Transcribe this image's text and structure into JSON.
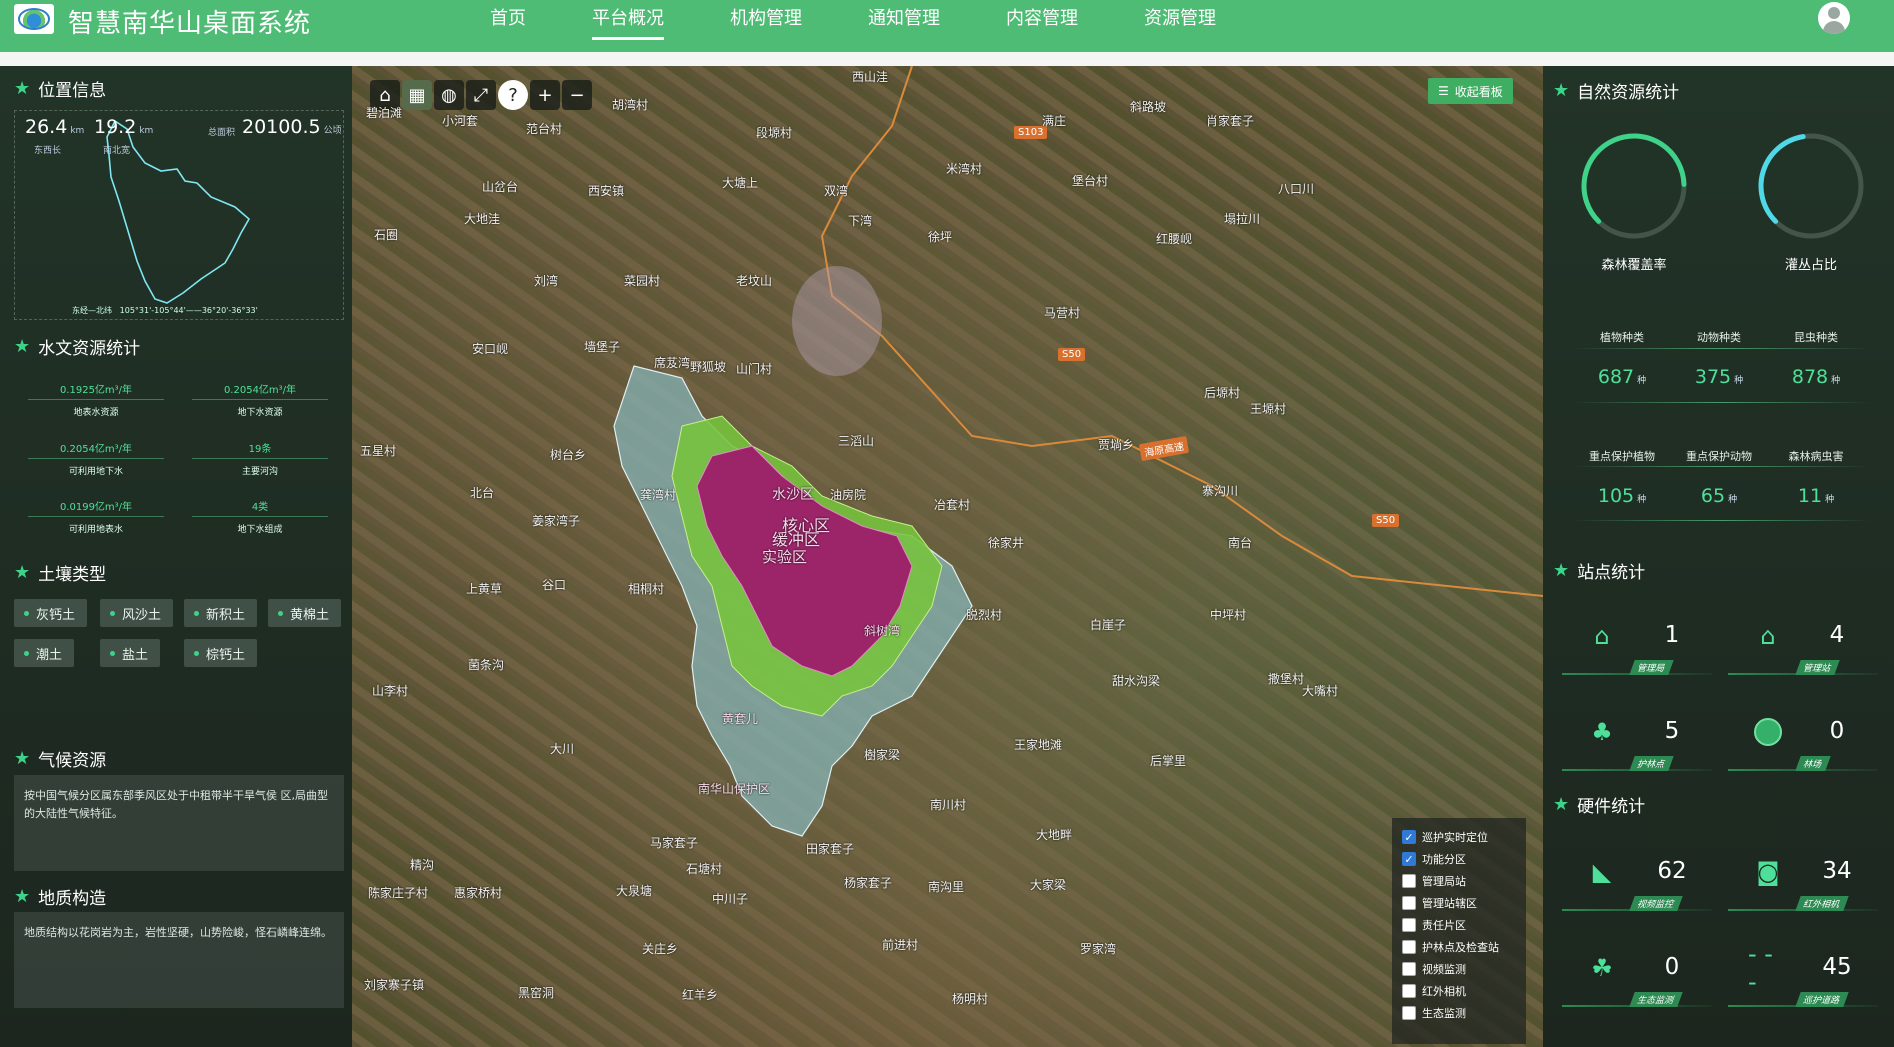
{
  "header": {
    "title": "智慧南华山桌面系统",
    "nav": [
      "首页",
      "平台概况",
      "机构管理",
      "通知管理",
      "内容管理",
      "资源管理"
    ],
    "active_nav": "平台概况"
  },
  "left": {
    "location": {
      "title": "位置信息",
      "east_west_length": "26.4",
      "north_south_length": "19.2",
      "length_unit": "km",
      "east_west_label": "东西长",
      "north_south_label": "南北宽",
      "area_label": "总面积",
      "area_value": "20100.5",
      "area_unit": "公顷",
      "coord_label": "东经—北纬",
      "coord_value": "105°31'-105°44'——36°20'-36°33'"
    },
    "hydro": {
      "title": "水文资源统计",
      "items": [
        {
          "value": "0.1925亿m³/年",
          "label": "地表水资源"
        },
        {
          "value": "0.2054亿m³/年",
          "label": "地下水资源"
        },
        {
          "value": "0.2054亿m³/年",
          "label": "可利用地下水"
        },
        {
          "value": "19条",
          "label": "主要河沟"
        },
        {
          "value": "0.0199亿m³/年",
          "label": "可利用地表水"
        },
        {
          "value": "4类",
          "label": "地下水组成"
        }
      ]
    },
    "soil": {
      "title": "土壤类型",
      "tags": [
        "灰钙土",
        "风沙土",
        "新积土",
        "黄棉土",
        "潮土",
        "盐土",
        "棕钙土"
      ]
    },
    "climate": {
      "title": "气候资源",
      "text": "按中国气候分区属东部季风区处于中租带半干旱气侯 区,局曲型的大陆性气候特征。"
    },
    "geology": {
      "title": "地质构造",
      "text": "地质结构以花岗岩为主，岩性坚硬，山势险峻，怪石嶙峰连绵。"
    }
  },
  "map": {
    "collapse_label": "收起看板",
    "labels": [
      {
        "text": "西山洼"
      },
      {
        "text": "碧泊滩"
      },
      {
        "text": "小河套"
      },
      {
        "text": "范台村"
      },
      {
        "text": "胡湾村"
      },
      {
        "text": "段塬村"
      },
      {
        "text": "满庄"
      },
      {
        "text": "斜路坡"
      },
      {
        "text": "肖家套子"
      },
      {
        "text": "山岔台"
      },
      {
        "text": "西安镇"
      },
      {
        "text": "大塘上"
      },
      {
        "text": "双湾"
      },
      {
        "text": "米湾村"
      },
      {
        "text": "堡台村"
      },
      {
        "text": "八口川"
      },
      {
        "text": "大地洼"
      },
      {
        "text": "石圈"
      },
      {
        "text": "下湾"
      },
      {
        "text": "徐坪"
      },
      {
        "text": "红腰岘"
      },
      {
        "text": "塌拉川"
      },
      {
        "text": "刘湾"
      },
      {
        "text": "菜园村"
      },
      {
        "text": "老坟山"
      },
      {
        "text": "马营村"
      },
      {
        "text": "安口岘"
      },
      {
        "text": "墙堡子"
      },
      {
        "text": "席芨湾"
      },
      {
        "text": "野狐坡"
      },
      {
        "text": "山门村"
      },
      {
        "text": "后塬村"
      },
      {
        "text": "王塬村"
      },
      {
        "text": "五星村"
      },
      {
        "text": "树台乡"
      },
      {
        "text": "三滔山"
      },
      {
        "text": "贾埫乡"
      },
      {
        "text": "北台"
      },
      {
        "text": "龚湾村"
      },
      {
        "text": "油房院"
      },
      {
        "text": "冶套村"
      },
      {
        "text": "寨沟川"
      },
      {
        "text": "姜家湾子"
      },
      {
        "text": "徐家井"
      },
      {
        "text": "南台"
      },
      {
        "text": "谷口"
      },
      {
        "text": "上黄草"
      },
      {
        "text": "相桐村"
      },
      {
        "text": "脱烈村"
      },
      {
        "text": "白崖子"
      },
      {
        "text": "中坪村"
      },
      {
        "text": "菌条沟"
      },
      {
        "text": "甜水沟梁"
      },
      {
        "text": "山李村"
      },
      {
        "text": "撒堡村"
      },
      {
        "text": "大嘴村"
      },
      {
        "text": "樹家梁"
      },
      {
        "text": "王家地滩"
      },
      {
        "text": "后掌里"
      },
      {
        "text": "大川"
      },
      {
        "text": "南川村"
      },
      {
        "text": "马家套子"
      },
      {
        "text": "田家套子"
      },
      {
        "text": "大地畔"
      },
      {
        "text": "精沟"
      },
      {
        "text": "石塘村"
      },
      {
        "text": "杨家套子"
      },
      {
        "text": "南沟里"
      },
      {
        "text": "大家梁"
      },
      {
        "text": "陈家庄子村"
      },
      {
        "text": "惠家桥村"
      },
      {
        "text": "大泉塘"
      },
      {
        "text": "中川子"
      },
      {
        "text": "关庄乡"
      },
      {
        "text": "前进村"
      },
      {
        "text": "罗家湾"
      },
      {
        "text": "刘家寨子镇"
      },
      {
        "text": "黑窑洞"
      },
      {
        "text": "红羊乡"
      },
      {
        "text": "杨明村"
      },
      {
        "text": "水沙区"
      },
      {
        "text": "核心区"
      },
      {
        "text": "缓冲区"
      },
      {
        "text": "实验区"
      },
      {
        "text": "斜树湾"
      },
      {
        "text": "黄套儿"
      },
      {
        "text": "南华山保护区"
      }
    ],
    "roads": [
      "S103",
      "S50",
      "S50",
      "海原高速"
    ],
    "layers": [
      {
        "label": "巡护实时定位",
        "checked": true
      },
      {
        "label": "功能分区",
        "checked": true
      },
      {
        "label": "管理局站",
        "checked": false
      },
      {
        "label": "管理站辖区",
        "checked": false
      },
      {
        "label": "责任片区",
        "checked": false
      },
      {
        "label": "护林点及检查站",
        "checked": false
      },
      {
        "label": "视频监测",
        "checked": false
      },
      {
        "label": "红外相机",
        "checked": false
      },
      {
        "label": "生态监测",
        "checked": false
      }
    ]
  },
  "right": {
    "nature": {
      "title": "自然资源统计",
      "gauges": [
        {
          "label": "森林覆盖率",
          "value": 0.62,
          "color": "#3fd38a"
        },
        {
          "label": "灌丛占比",
          "value": 0.35,
          "color": "#4fd8e8"
        }
      ],
      "stats_row1": [
        {
          "label": "植物种类",
          "value": "687",
          "unit": "种"
        },
        {
          "label": "动物种类",
          "value": "375",
          "unit": "种"
        },
        {
          "label": "昆虫种类",
          "value": "878",
          "unit": "种"
        }
      ],
      "stats_row2": [
        {
          "label": "重点保护植物",
          "value": "105",
          "unit": "种"
        },
        {
          "label": "重点保护动物",
          "value": "65",
          "unit": "种"
        },
        {
          "label": "森林病虫害",
          "value": "11",
          "unit": "种"
        }
      ]
    },
    "sites": {
      "title": "站点统计",
      "items": [
        {
          "icon": "house-icon",
          "value": "1",
          "label": "管理局"
        },
        {
          "icon": "station-icon",
          "value": "4",
          "label": "管理站"
        },
        {
          "icon": "tree-icon",
          "value": "5",
          "label": "护林点"
        },
        {
          "icon": "circle-icon",
          "value": "0",
          "label": "林场"
        }
      ]
    },
    "hardware": {
      "title": "硬件统计",
      "items": [
        {
          "icon": "cctv-icon",
          "value": "62",
          "label": "视频监控"
        },
        {
          "icon": "camera-icon",
          "value": "34",
          "label": "红外相机"
        },
        {
          "icon": "sprout-icon",
          "value": "0",
          "label": "生态监测"
        },
        {
          "icon": "path-icon",
          "value": "45",
          "label": "巡护道路"
        }
      ]
    }
  }
}
